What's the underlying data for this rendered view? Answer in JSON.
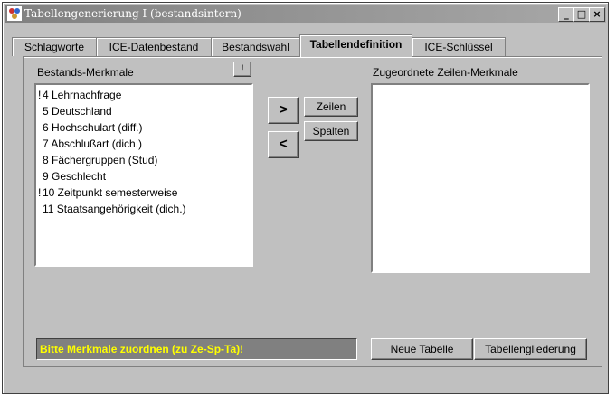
{
  "window": {
    "title": "Tabellengenerierung I (bestandsintern)",
    "controls": {
      "minimize": "_",
      "maximize": "□",
      "close": "×"
    }
  },
  "tabs": [
    {
      "label": "Schlagworte",
      "active": false
    },
    {
      "label": "ICE-Datenbestand",
      "active": false
    },
    {
      "label": "Bestandswahl",
      "active": false
    },
    {
      "label": "Tabellendefinition",
      "active": true
    },
    {
      "label": "ICE-Schlüssel",
      "active": false
    }
  ],
  "left_list": {
    "label": "Bestands-Merkmale",
    "info_button": "!",
    "items": [
      {
        "marker": "!",
        "text": "4  Lehrnachfrage"
      },
      {
        "marker": "",
        "text": "5  Deutschland"
      },
      {
        "marker": "",
        "text": "6  Hochschulart (diff.)"
      },
      {
        "marker": "",
        "text": "7  Abschlußart (dich.)"
      },
      {
        "marker": "",
        "text": "8  Fächergruppen (Stud)"
      },
      {
        "marker": "",
        "text": "9  Geschlecht"
      },
      {
        "marker": "!",
        "text": "10  Zeitpunkt semesterweise"
      },
      {
        "marker": "",
        "text": "11  Staatsangehörigkeit (dich.)"
      }
    ]
  },
  "controls": {
    "add_label": ">",
    "remove_label": "<",
    "rows_label": "Zeilen",
    "columns_label": "Spalten"
  },
  "right_list": {
    "label": "Zugeordnete Zeilen-Merkmale",
    "items": []
  },
  "status": {
    "message": "Bitte Merkmale zuordnen (zu Ze-Sp-Ta)!",
    "text_color": "#ffff00",
    "background": "#808080"
  },
  "actions": {
    "new_table": "Neue Tabelle",
    "table_structure": "Tabellengliederung"
  }
}
